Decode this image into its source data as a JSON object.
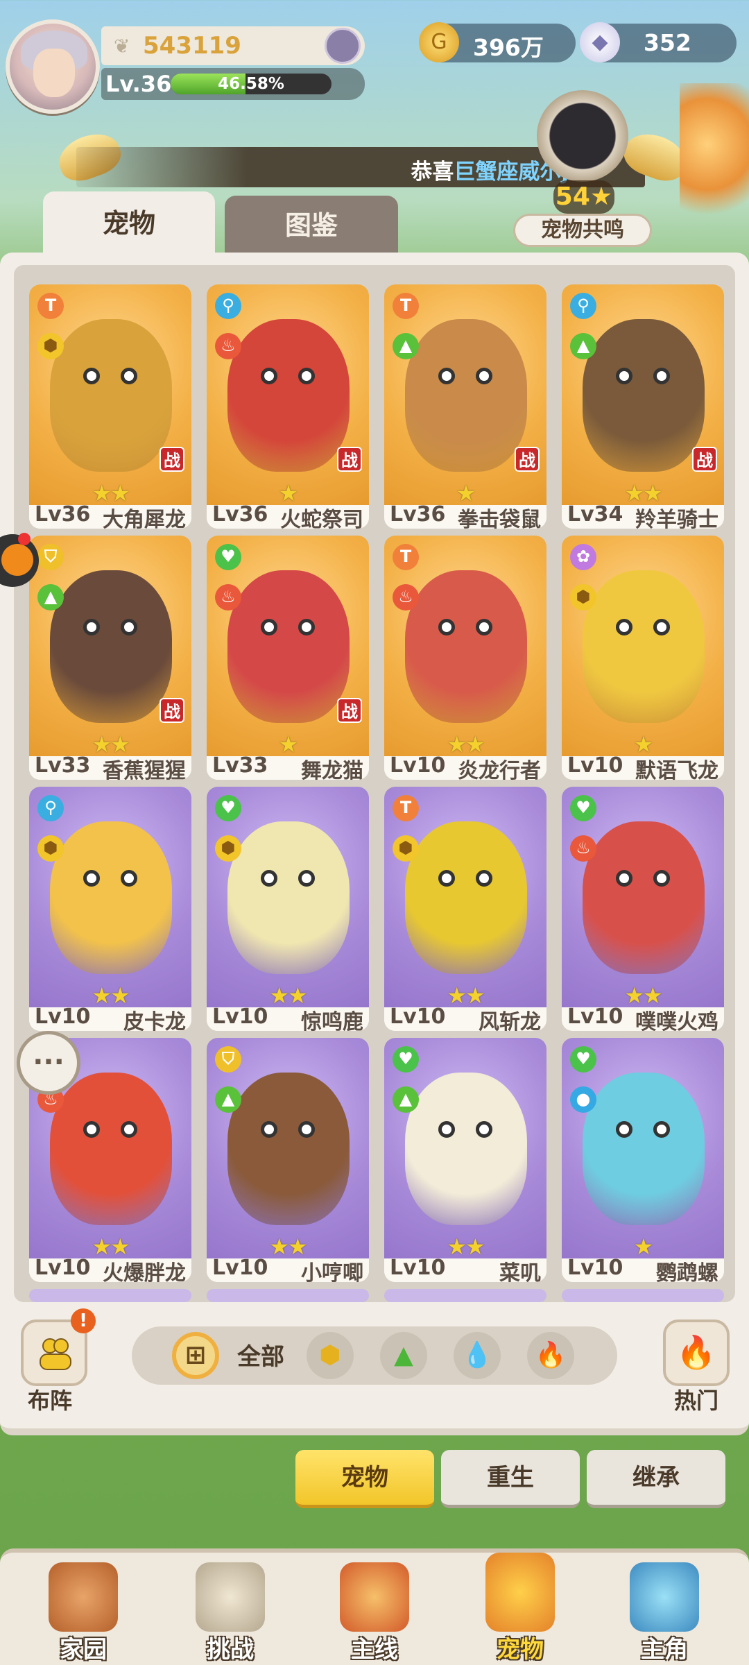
{
  "player": {
    "score": "543119",
    "level_label": "Lv.36",
    "exp_percent_text": "46.58%",
    "exp_fraction": 0.4658
  },
  "currency": {
    "gold": "396万",
    "gems": "352"
  },
  "banner": {
    "prefix": "恭喜",
    "highlight": "巨蟹座威尔j"
  },
  "resonance": {
    "count": "54",
    "label": "宠物共鸣"
  },
  "tabs": {
    "pet": "宠物",
    "dex": "图鉴"
  },
  "pets": [
    {
      "level": "Lv36",
      "name": "大角犀龙",
      "stars": 2,
      "battle": true,
      "theme": "orange",
      "icon1": "hammer-icon",
      "icon2": "earth-icon",
      "color": "#d9a23a"
    },
    {
      "level": "Lv36",
      "name": "火蛇祭司",
      "stars": 1,
      "battle": true,
      "theme": "orange",
      "icon1": "staff-icon",
      "icon2": "fire-icon",
      "color": "#d4453a"
    },
    {
      "level": "Lv36",
      "name": "拳击袋鼠",
      "stars": 1,
      "battle": true,
      "theme": "orange",
      "icon1": "hammer-icon",
      "icon2": "grass-icon",
      "color": "#c98a4a"
    },
    {
      "level": "Lv34",
      "name": "羚羊骑士",
      "stars": 2,
      "battle": true,
      "theme": "orange",
      "icon1": "staff-icon",
      "icon2": "grass-icon",
      "color": "#7a5a3a"
    },
    {
      "level": "Lv33",
      "name": "香蕉猩猩",
      "stars": 2,
      "battle": true,
      "theme": "orange",
      "icon1": "shield-icon",
      "icon2": "grass-icon",
      "color": "#6a4a3a"
    },
    {
      "level": "Lv33",
      "name": "舞龙猫",
      "stars": 1,
      "battle": true,
      "theme": "orange",
      "icon1": "heart-icon",
      "icon2": "fire-icon",
      "color": "#d44848"
    },
    {
      "level": "Lv10",
      "name": "炎龙行者",
      "stars": 2,
      "battle": false,
      "theme": "orange",
      "icon1": "hammer-icon",
      "icon2": "fire-icon",
      "color": "#d85a4a"
    },
    {
      "level": "Lv10",
      "name": "默语飞龙",
      "stars": 1,
      "battle": false,
      "theme": "orange",
      "icon1": "magic-icon",
      "icon2": "earth-icon",
      "color": "#f0c840"
    },
    {
      "level": "Lv10",
      "name": "皮卡龙",
      "stars": 2,
      "battle": false,
      "theme": "purple",
      "icon1": "staff-icon",
      "icon2": "earth-icon",
      "color": "#f2c24a"
    },
    {
      "level": "Lv10",
      "name": "惊鸣鹿",
      "stars": 2,
      "battle": false,
      "theme": "purple",
      "icon1": "heart-icon",
      "icon2": "earth-icon",
      "color": "#f0e7b0"
    },
    {
      "level": "Lv10",
      "name": "风斩龙",
      "stars": 2,
      "battle": false,
      "theme": "purple",
      "icon1": "hammer-icon",
      "icon2": "earth-icon",
      "color": "#e8c830"
    },
    {
      "level": "Lv10",
      "name": "噗噗火鸡",
      "stars": 2,
      "battle": false,
      "theme": "purple",
      "icon1": "heart-icon",
      "icon2": "fire-icon",
      "color": "#d8504a"
    },
    {
      "level": "Lv10",
      "name": "火爆胖龙",
      "stars": 2,
      "battle": false,
      "theme": "purple",
      "icon1": "hammer-icon",
      "icon2": "fire-icon",
      "color": "#e2503a"
    },
    {
      "level": "Lv10",
      "name": "小哼唧",
      "stars": 2,
      "battle": false,
      "theme": "purple",
      "icon1": "shield-icon",
      "icon2": "grass-icon",
      "color": "#8a5a3a"
    },
    {
      "level": "Lv10",
      "name": "菜叽",
      "stars": 2,
      "battle": false,
      "theme": "purple",
      "icon1": "heart-icon",
      "icon2": "grass-icon",
      "color": "#f3ecd8"
    },
    {
      "level": "Lv10",
      "name": "鹦鹉螺",
      "stars": 1,
      "battle": false,
      "theme": "purple",
      "icon1": "heart-icon",
      "icon2": "water-icon",
      "color": "#6ecde0"
    }
  ],
  "filter": {
    "team_label": "布阵",
    "team_badge": "!",
    "all_label": "全部",
    "hot_label": "热门",
    "elements": [
      "earth-icon",
      "grass-icon",
      "water-icon",
      "fire-icon"
    ]
  },
  "sub_buttons": {
    "pet": "宠物",
    "reborn": "重生",
    "inherit": "继承"
  },
  "nav": {
    "home": "家园",
    "challenge": "挑战",
    "main": "主线",
    "pet": "宠物",
    "hero": "主角"
  },
  "chat_icon_text": "···"
}
